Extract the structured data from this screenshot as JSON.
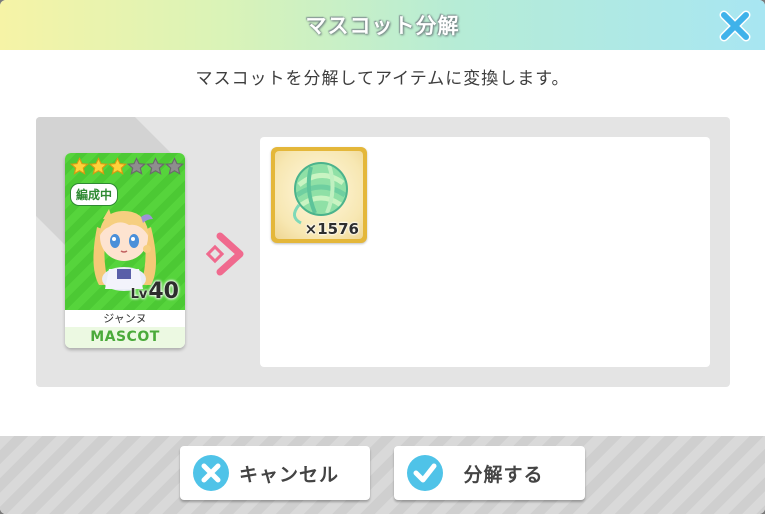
{
  "dialog": {
    "title": "マスコット分解",
    "subtitle": "マスコットを分解してアイテムに変換します。"
  },
  "mascot_card": {
    "stars_filled": 3,
    "stars_total": 6,
    "status_badge": "編成中",
    "level_prefix": "Lv",
    "level": "40",
    "name": "ジャンヌ",
    "type_label": "MASCOT"
  },
  "result_item": {
    "icon": "yarn-ball-icon",
    "count": "×1576"
  },
  "buttons": {
    "cancel_label": "キャンセル",
    "confirm_label": "分解する"
  },
  "colors": {
    "accent_blue": "#42b4ea",
    "cancel_icon": "#4fc3e8",
    "confirm_icon": "#4fc3e8",
    "arrow_pink": "#f06a8e",
    "card_green": "#56d43c",
    "item_gold": "#e4b73a"
  }
}
